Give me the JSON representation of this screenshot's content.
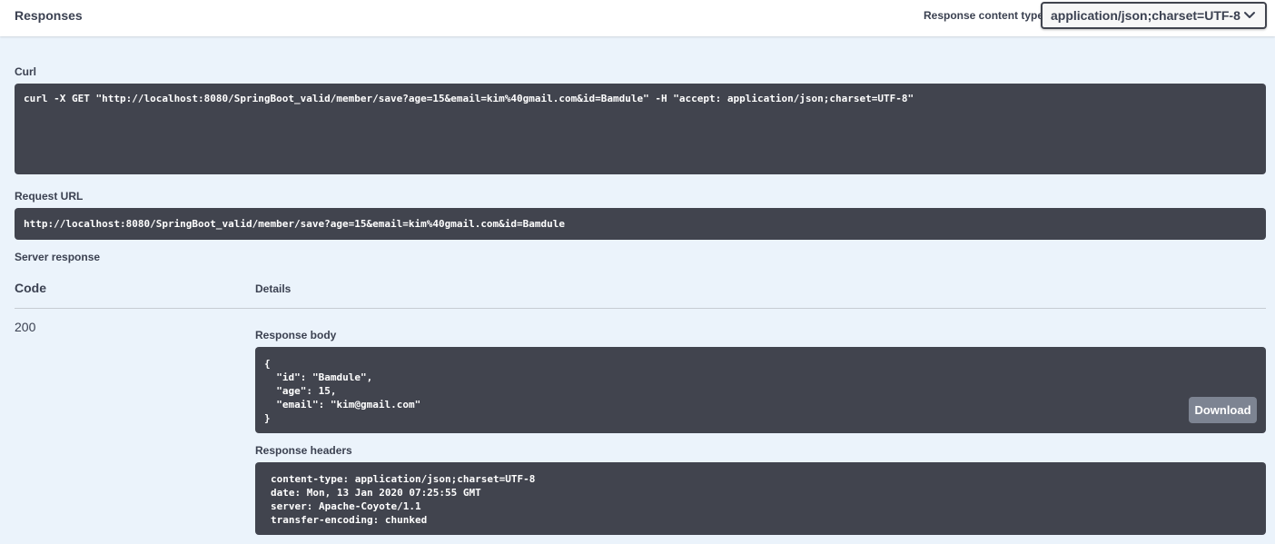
{
  "header": {
    "title": "Responses",
    "content_type_label": "Response content type",
    "content_type_value": "application/json;charset=UTF-8"
  },
  "curl": {
    "label": "Curl",
    "command": "curl -X GET \"http://localhost:8080/SpringBoot_valid/member/save?age=15&email=kim%40gmail.com&id=Bamdule\" -H \"accept: application/json;charset=UTF-8\""
  },
  "request_url": {
    "label": "Request URL",
    "url": "http://localhost:8080/SpringBoot_valid/member/save?age=15&email=kim%40gmail.com&id=Bamdule"
  },
  "server_response": {
    "label": "Server response",
    "code_header": "Code",
    "details_header": "Details",
    "code": "200",
    "response_body_label": "Response body",
    "response_body": "{\n  \"id\": \"Bamdule\",\n  \"age\": 15,\n  \"email\": \"kim@gmail.com\"\n}",
    "download_label": "Download",
    "response_headers_label": "Response headers",
    "response_headers": "content-type: application/json;charset=UTF-8\ndate: Mon, 13 Jan 2020 07:25:55 GMT\nserver: Apache-Coyote/1.1\ntransfer-encoding: chunked"
  },
  "icons": {
    "select_chevron": "chevron-down-icon"
  },
  "colors": {
    "background": "#ebf3fb",
    "code_block": "#41444e",
    "download_button": "#7d8492",
    "text": "#3b4151"
  }
}
